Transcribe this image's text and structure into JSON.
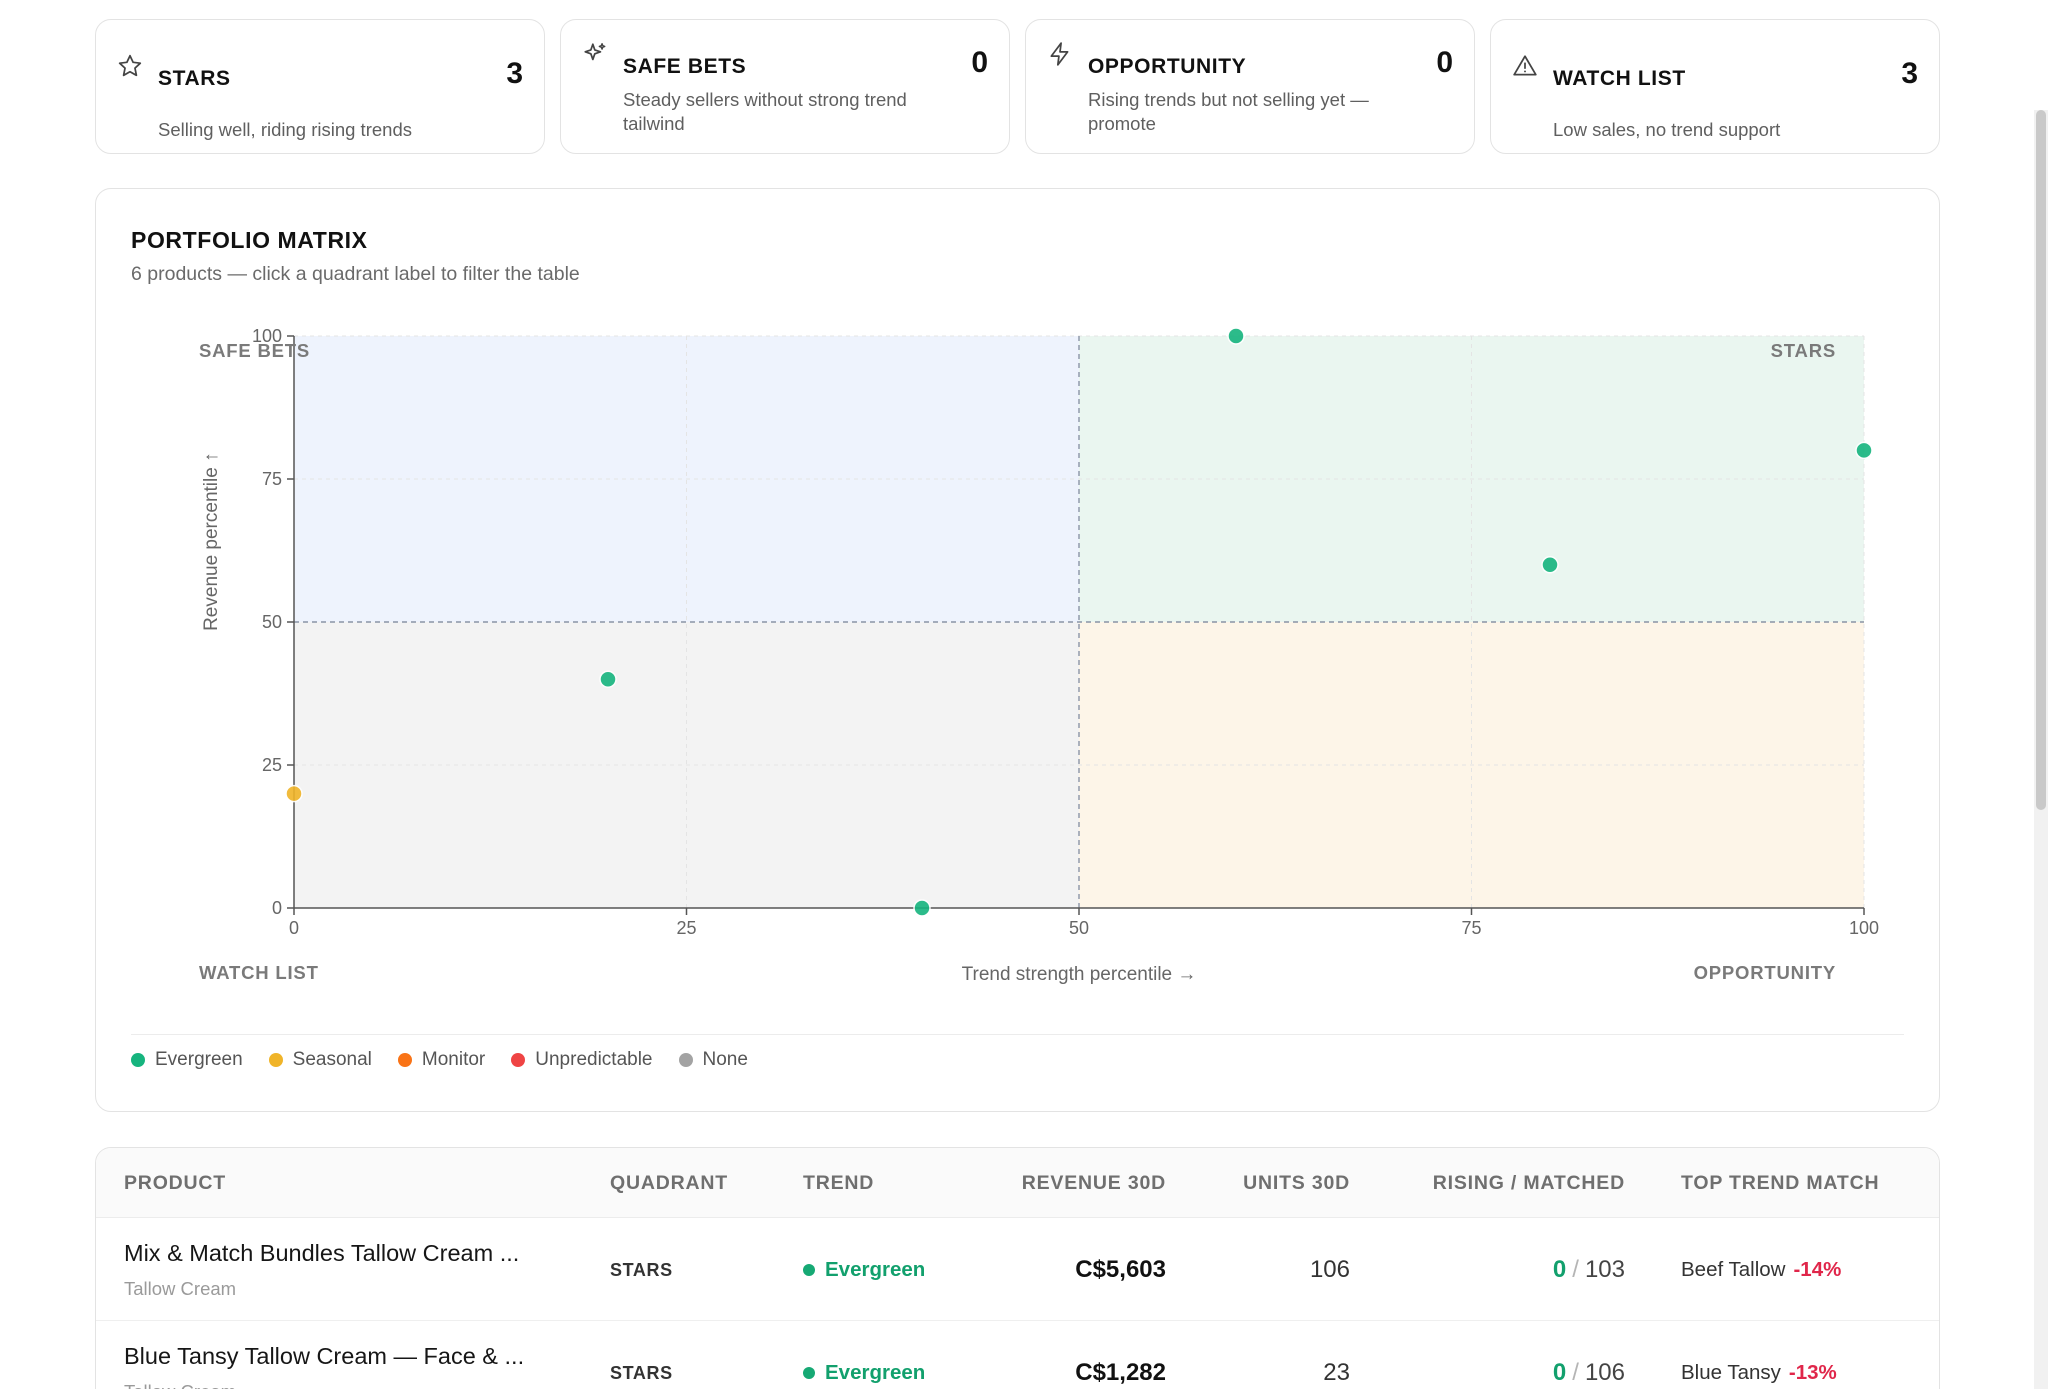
{
  "kpis": [
    {
      "title": "STARS",
      "desc": "Selling well, riding rising trends",
      "count": "3",
      "icon": "star-icon"
    },
    {
      "title": "SAFE BETS",
      "desc": "Steady sellers without strong trend tailwind",
      "count": "0",
      "icon": "sparkle-icon"
    },
    {
      "title": "OPPORTUNITY",
      "desc": "Rising trends but not selling yet — promote",
      "count": "0",
      "icon": "bolt-icon"
    },
    {
      "title": "WATCH LIST",
      "desc": "Low sales, no trend support",
      "count": "3",
      "icon": "warning-icon"
    }
  ],
  "matrix": {
    "title": "PORTFOLIO MATRIX",
    "subtitle": "6 products — click a quadrant label to filter the table",
    "quadrant_labels": {
      "top_left": "SAFE BETS",
      "top_right": "STARS",
      "bottom_left": "WATCH LIST",
      "bottom_right": "OPPORTUNITY"
    },
    "quadrant_colors": {
      "top_left": "#eef3fd",
      "top_right": "#eaf6f0",
      "bottom_left": "#f3f3f3",
      "bottom_right": "#fdf5e8"
    }
  },
  "chart_data": {
    "type": "scatter",
    "xlabel": "Trend strength percentile →",
    "ylabel": "Revenue percentile ↑",
    "xlim": [
      0,
      100
    ],
    "ylim": [
      0,
      100
    ],
    "x_ticks": [
      0,
      25,
      50,
      75,
      100
    ],
    "y_ticks": [
      0,
      25,
      50,
      75,
      100
    ],
    "dividers": {
      "x": 50,
      "y": 50
    },
    "grid": true,
    "points": [
      {
        "x": 60,
        "y": 100,
        "category": "Evergreen"
      },
      {
        "x": 100,
        "y": 80,
        "category": "Evergreen"
      },
      {
        "x": 80,
        "y": 60,
        "category": "Evergreen"
      },
      {
        "x": 20,
        "y": 40,
        "category": "Evergreen"
      },
      {
        "x": 0,
        "y": 20,
        "category": "Seasonal"
      },
      {
        "x": 40,
        "y": 0,
        "category": "Evergreen"
      }
    ]
  },
  "legend": [
    {
      "label": "Evergreen",
      "color": "#16b47e"
    },
    {
      "label": "Seasonal",
      "color": "#f0b429"
    },
    {
      "label": "Monitor",
      "color": "#f97316"
    },
    {
      "label": "Unpredictable",
      "color": "#ef4444"
    },
    {
      "label": "None",
      "color": "#a3a3a3"
    }
  ],
  "table": {
    "headers": {
      "product": "PRODUCT",
      "quadrant": "QUADRANT",
      "trend": "TREND",
      "revenue": "REVENUE 30D",
      "units": "UNITS 30D",
      "rising": "RISING / MATCHED",
      "top_match": "TOP TREND MATCH"
    },
    "rows": [
      {
        "name": "Mix & Match Bundles Tallow Cream ...",
        "category": "Tallow Cream",
        "quadrant": "STARS",
        "trend": "Evergreen",
        "revenue": "C$5,603",
        "units": "106",
        "rising": "0",
        "matched": "103",
        "match_name": "Beef Tallow",
        "match_change": "-14%"
      },
      {
        "name": "Blue Tansy Tallow Cream — Face & ...",
        "category": "Tallow Cream",
        "quadrant": "STARS",
        "trend": "Evergreen",
        "revenue": "C$1,282",
        "units": "23",
        "rising": "0",
        "matched": "106",
        "match_name": "Blue Tansy",
        "match_change": "-13%"
      }
    ]
  }
}
